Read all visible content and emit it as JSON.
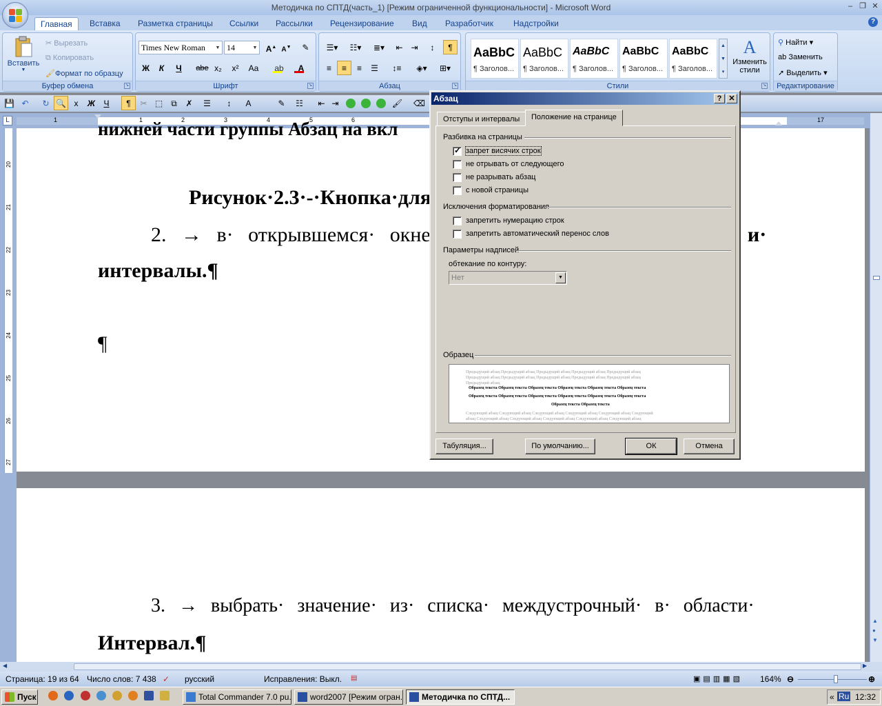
{
  "window": {
    "title": "Методичка по СПТД(часть_1) [Режим ограниченной функциональности] - Microsoft Word"
  },
  "tabs": [
    "Главная",
    "Вставка",
    "Разметка страницы",
    "Ссылки",
    "Рассылки",
    "Рецензирование",
    "Вид",
    "Разработчик",
    "Надстройки"
  ],
  "clipboard": {
    "paste": "Вставить",
    "cut": "Вырезать",
    "copy": "Копировать",
    "format_painter": "Формат по образцу",
    "group": "Буфер обмена"
  },
  "font": {
    "name": "Times New Roman",
    "size": "14",
    "group": "Шрифт",
    "bold": "Ж",
    "italic": "К",
    "underline": "Ч",
    "strike": "abe",
    "sub": "x₂",
    "sup": "x²",
    "case": "Aa"
  },
  "paragraph": {
    "group": "Абзац"
  },
  "styles": {
    "group": "Стили",
    "items": [
      {
        "big": "AaBbC",
        "label": "¶ Заголов..."
      },
      {
        "big": "AaBbC",
        "label": "¶ Заголов..."
      },
      {
        "big": "AaBbC",
        "label": "¶ Заголов..."
      },
      {
        "big": "AaBbC",
        "label": "¶ Заголов..."
      },
      {
        "big": "AaBbC",
        "label": "¶ Заголов..."
      }
    ],
    "change": "Изменить стили"
  },
  "editing": {
    "group": "Редактирование",
    "find": "Найти",
    "replace": "Заменить",
    "select": "Выделить"
  },
  "ruler_numbers": [
    "1",
    "1",
    "2",
    "3",
    "4",
    "5",
    "6",
    "17"
  ],
  "vruler_numbers": [
    "20",
    "21",
    "22",
    "23",
    "24",
    "25",
    "26",
    "27"
  ],
  "document": {
    "line_top": "нижней части группы Абзац на вкл",
    "caption": "Рисунок·2.3·-·Кнопка·для·",
    "item2_a": "2. → в· открывшемся· окне·",
    "item2_b": "ы· и·",
    "item2_c": "интервалы.¶",
    "para_mark": "¶",
    "item3_a": "3. → выбрать· значение· из· списка· междустрочный· в· области·",
    "item3_b": "Интервал.¶"
  },
  "dialog": {
    "title": "Абзац",
    "tab1": "Отступы и интервалы",
    "tab2": "Положение на странице",
    "section_pagination": "Разбивка на страницы",
    "cb1": "запрет висячих строк",
    "cb2": "не отрывать от следующего",
    "cb3": "не разрывать абзац",
    "cb4": "с новой страницы",
    "section_exceptions": "Исключения форматирования",
    "cb5": "запретить нумерацию строк",
    "cb6": "запретить автоматический перенос слов",
    "section_textbox": "Параметры надписей",
    "wrap_label": "обтекание по контуру:",
    "wrap_value": "Нет",
    "section_preview": "Образец",
    "preview_prev": "Предыдущий абзац Предыдущий абзац Предыдущий абзац Предыдущий абзац Предыдущий абзац",
    "preview_prev2": "Предыдущий абзац Предыдущий абзац Предыдущий абзац Предыдущий абзац Предыдущий абзац",
    "preview_prev3": "Предыдущий абзац",
    "preview_text": "Образец текста Образец текста Образец текста Образец текста Образец текста Образец текста",
    "preview_text2": "Образец текста Образец текста Образец текста Образец текста Образец текста Образец текста",
    "preview_text3": "Образец текста Образец текста",
    "preview_next": "Следующий абзац Следующий абзац Следующий абзац Следующий абзац Следующий абзац Следующий",
    "preview_next2": "абзац Следующий абзац Следующий абзац Следующий абзац Следующий абзац Следующий абзац",
    "btn_tabs": "Табуляция...",
    "btn_default": "По умолчанию...",
    "btn_ok": "ОК",
    "btn_cancel": "Отмена"
  },
  "status": {
    "page": "Страница: 19 из 64",
    "words": "Число слов: 7 438",
    "lang": "русский",
    "track": "Исправления: Выкл.",
    "zoom": "164%"
  },
  "taskbar": {
    "start": "Пуск",
    "tasks": [
      "Total Commander 7.0 pu...",
      "word2007 [Режим огран...",
      "Методичка по СПТД..."
    ],
    "lang": "Ru",
    "time": "12:32"
  },
  "colors": {
    "ribbon": "#c5d8f1",
    "dialog_title": "#0a246a",
    "taskbar": "#d4d0c8"
  }
}
